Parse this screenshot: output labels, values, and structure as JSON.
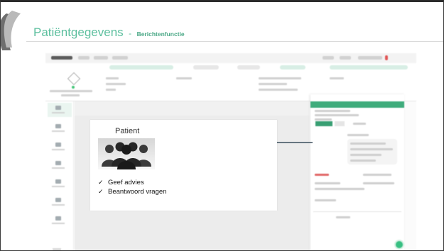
{
  "slide": {
    "title": "Patiëntgegevens",
    "separator": "-",
    "subtitle": "Berichtenfunctie"
  },
  "callout": {
    "title": "Patient",
    "items": [
      "Geef advies",
      "Beantwoord vragen"
    ],
    "check_icon": "checkmark-icon",
    "illustration_icon": "people-group-icon"
  },
  "colors": {
    "title_green": "#5cbf9e",
    "panel_green": "#35a876",
    "fab_green": "#2ebc7c",
    "arrow": "#3b4f5c"
  }
}
